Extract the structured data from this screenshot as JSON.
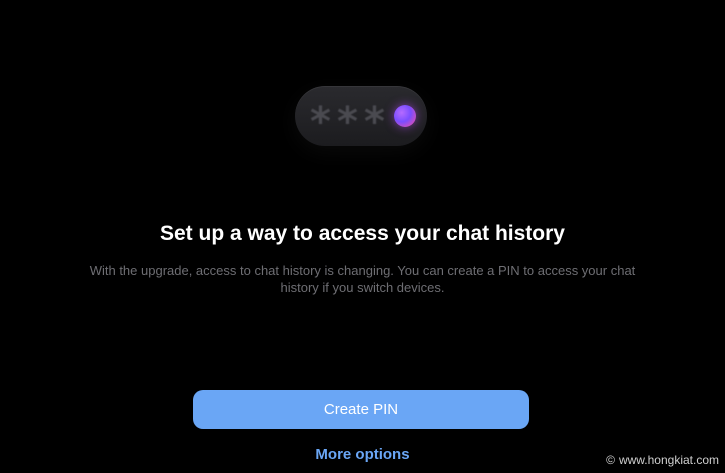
{
  "illustration": {
    "pin_chars": [
      "*",
      "*",
      "*"
    ],
    "cursor_icon": "purple-gradient-dot",
    "colors": {
      "pill_background": "#222226",
      "asterisk": "#4a4a50",
      "cursor_gradient": [
        "#b56bff",
        "#7b4dff",
        "#ff4f9a"
      ]
    }
  },
  "main": {
    "title": "Set up a way to access your chat history",
    "description": "With the upgrade, access to chat history is changing. You can create a PIN to access your chat history if you switch devices."
  },
  "actions": {
    "primary_label": "Create PIN",
    "secondary_label": "More options"
  },
  "watermark": {
    "symbol": "©",
    "text": "www.hongkiat.com"
  },
  "theme": {
    "background": "#000000",
    "accent": "#6aa6f5",
    "text_primary": "#ffffff",
    "text_secondary": "#6e6e73"
  }
}
